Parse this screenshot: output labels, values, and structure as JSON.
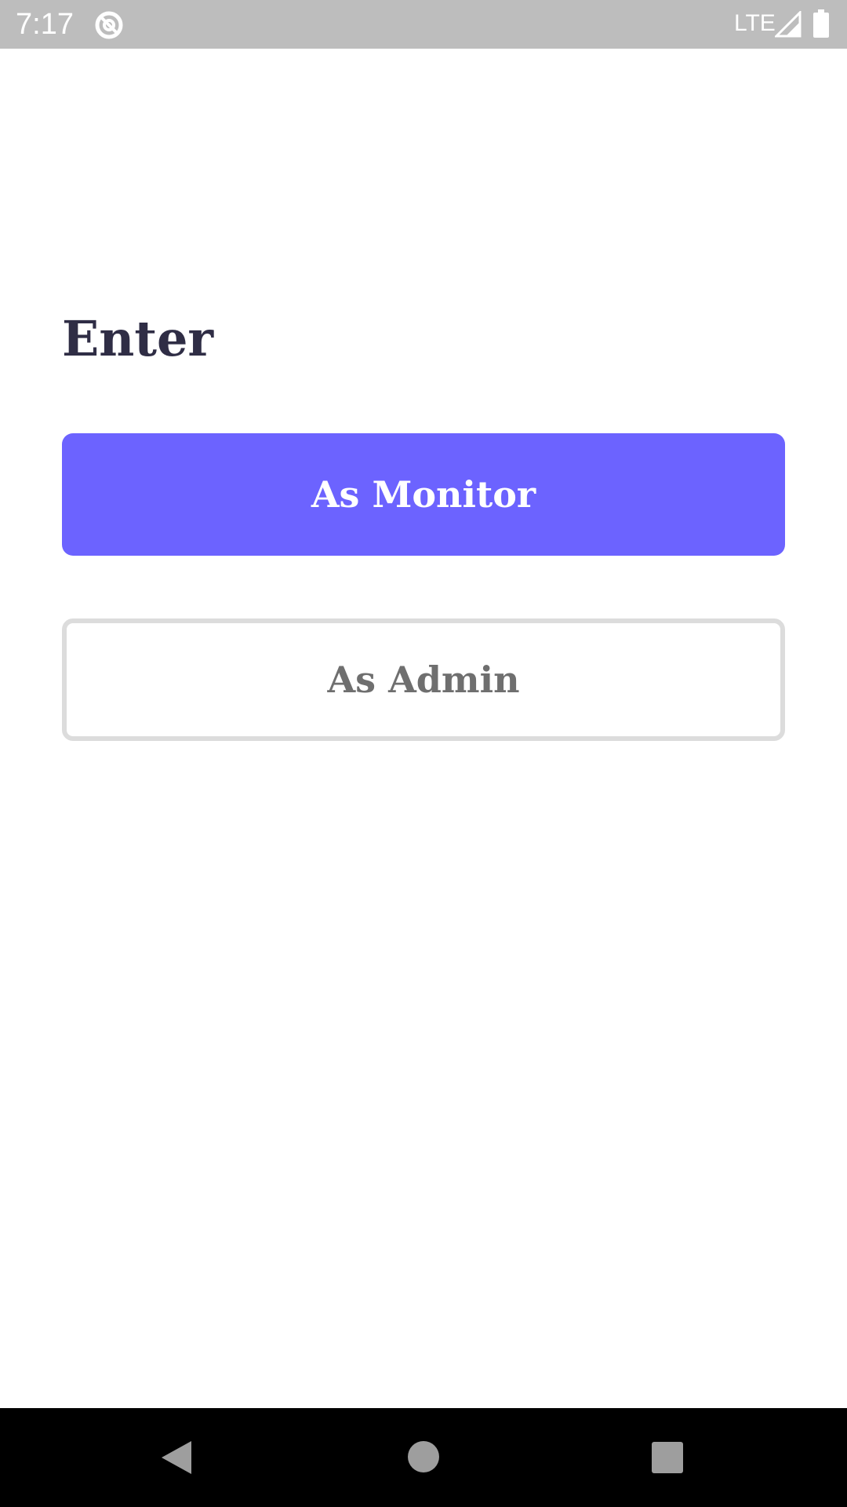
{
  "status_bar": {
    "time": "7:17",
    "network_label": "LTE",
    "icons": [
      "do-not-disturb-icon",
      "signal-icon",
      "battery-icon"
    ]
  },
  "page": {
    "title": "Enter"
  },
  "buttons": {
    "monitor_label": "As Monitor",
    "admin_label": "As Admin"
  },
  "navigation_bar": {
    "icons": [
      "back-icon",
      "home-icon",
      "recents-icon"
    ]
  },
  "colors": {
    "accent": "#6c63ff",
    "title_text": "#2f2d45",
    "secondary_text": "#6f6f6f",
    "secondary_border": "#dcdcdc",
    "status_bar": "#bdbdbd",
    "nav_bar": "#000000"
  }
}
